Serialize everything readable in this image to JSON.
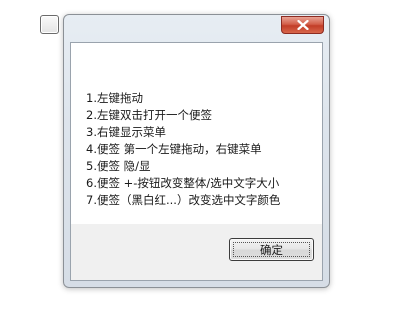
{
  "dialog": {
    "close_icon": "close-icon",
    "instructions": [
      "1.左键拖动",
      "2.左键双击打开一个便签",
      "3.右键显示菜单",
      "4.便签 第一个左键拖动，右键菜单",
      "5.便签 隐/显",
      "6.便签 +-按钮改变整体/选中文字大小",
      "7.便签（黑白红...）改变选中文字颜色"
    ],
    "ok_label": "确定"
  },
  "colors": {
    "close_button": "#c94a34",
    "dialog_frame": "#dde4ec",
    "content_background": "#ffffff"
  }
}
